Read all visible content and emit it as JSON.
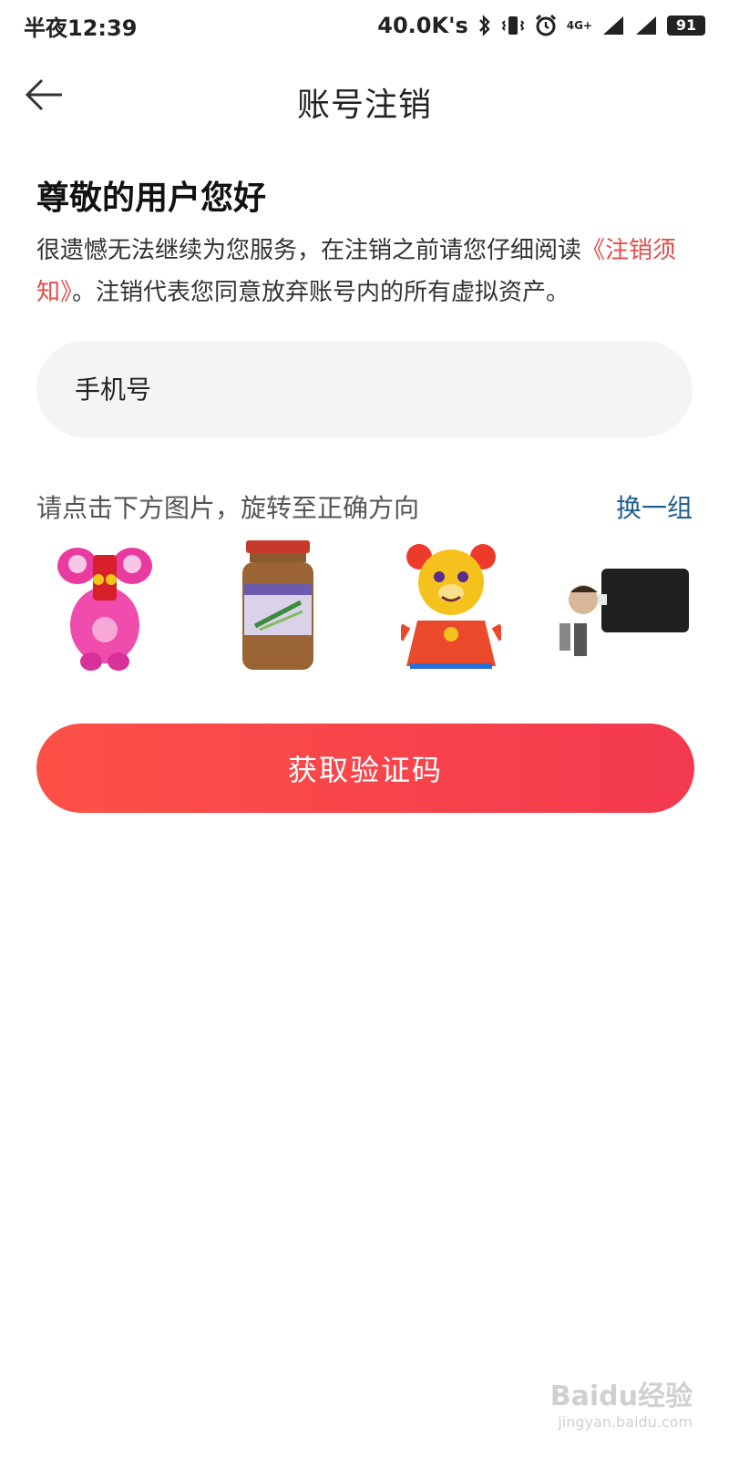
{
  "status_bar": {
    "time": "半夜12:39",
    "network_speed": "40.0K's",
    "network_type": "4G+",
    "battery": "91",
    "icons": [
      "bluetooth-icon",
      "vibrate-icon",
      "alarm-icon",
      "signal-icon",
      "signal-icon",
      "battery-icon"
    ]
  },
  "header": {
    "title": "账号注销",
    "back_icon": "back-arrow-icon"
  },
  "main": {
    "greeting": "尊敬的用户您好",
    "notice_prefix": "很遗憾无法继续为您服务，在注销之前请您仔细阅读",
    "notice_link": "《注销须知》",
    "notice_suffix": "。注销代表您同意放弃账号内的所有虚拟资产。",
    "phone_placeholder": "手机号",
    "captcha_hint": "请点击下方图片，旋转至正确方向",
    "captcha_refresh": "换一组",
    "captcha_images": [
      "pink-toy-image",
      "jar-image",
      "bear-toy-image",
      "person-image"
    ],
    "submit_label": "获取验证码"
  },
  "watermark": {
    "main": "Baidu经验",
    "sub": "jingyan.baidu.com"
  },
  "colors": {
    "accent": "#f4394f",
    "link_red": "#e34d4a",
    "link_blue": "#1f5f91",
    "input_bg": "#f4f4f4"
  }
}
